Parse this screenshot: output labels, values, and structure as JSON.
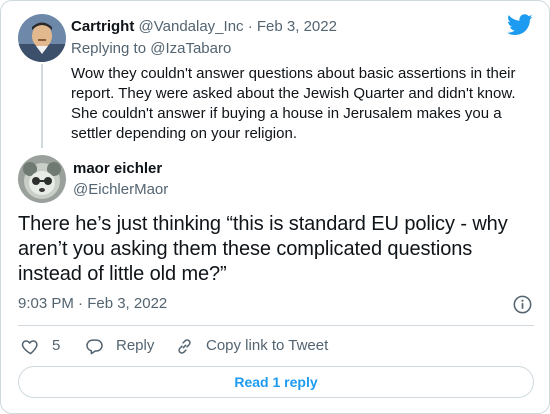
{
  "parent": {
    "name": "Cartright",
    "handle": "@Vandalay_Inc",
    "separator": "·",
    "date": "Feb 3, 2022",
    "replying_prefix": "Replying to ",
    "replying_handle": "@IzaTabaro",
    "text": "Wow they couldn't answer questions about basic assertions in their report. They were asked about the Jewish Quarter and didn't know. She couldn't answer if buying a house in Jerusalem makes you a settler depending on your religion."
  },
  "main": {
    "name": "maor eichler",
    "handle": "@EichlerMaor",
    "text": "There he’s just thinking “this is standard EU policy - why aren’t you asking them these complicated questions instead of little old me?”",
    "time": "9:03 PM · Feb 3, 2022"
  },
  "actions": {
    "likes": "5",
    "reply_label": "Reply",
    "copy_label": "Copy link to Tweet"
  },
  "read_replies_label": "Read 1 reply",
  "icons": {
    "brand": "twitter-bird-icon",
    "like": "heart-icon",
    "reply": "reply-bubble-icon",
    "copy": "link-icon",
    "info": "info-icon"
  },
  "colors": {
    "accent": "#1d9bf0",
    "text": "#0f1419",
    "muted": "#536471",
    "border": "#cfd9de"
  }
}
